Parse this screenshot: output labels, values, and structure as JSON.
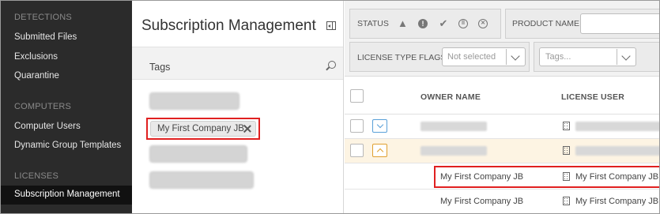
{
  "sidebar": {
    "sections": [
      {
        "title": "DETECTIONS",
        "items": [
          "Submitted Files",
          "Exclusions",
          "Quarantine"
        ]
      },
      {
        "title": "COMPUTERS",
        "items": [
          "Computer Users",
          "Dynamic Group Templates"
        ]
      },
      {
        "title": "LICENSES",
        "items": [
          "Subscription Management"
        ]
      }
    ],
    "active_item": "Subscription Management"
  },
  "middle": {
    "title": "Subscription Management",
    "tags_label": "Tags",
    "selected_tag": "My First Company JB"
  },
  "filters": {
    "status_label": "STATUS",
    "status_icons": [
      "warning-icon",
      "alert-circle-icon",
      "checkmark-icon",
      "pause-circle-icon",
      "cancel-circle-icon"
    ],
    "product_name_label": "PRODUCT NAME",
    "license_type_flags_label": "LICENSE TYPE FLAGS",
    "license_type_flags_value": "Not selected",
    "tags_placeholder": "Tags..."
  },
  "table": {
    "columns": [
      "OWNER NAME",
      "LICENSE USER"
    ],
    "rows": [
      {
        "expand": "collapsed",
        "owner": "",
        "user": ""
      },
      {
        "expand": "expanded",
        "owner": "",
        "user": ""
      },
      {
        "expand": "none",
        "owner": "My First Company JB",
        "user": "My First Company JB"
      },
      {
        "expand": "none",
        "owner": "My First Company JB",
        "user": "My First Company JB"
      }
    ]
  },
  "colors": {
    "sidebar_bg": "#2b2b2b",
    "highlight_red": "#e02020",
    "expanded_row_bg": "#fdf4e3",
    "expand_blue": "#5aa0d8",
    "expand_orange": "#e0a030"
  }
}
